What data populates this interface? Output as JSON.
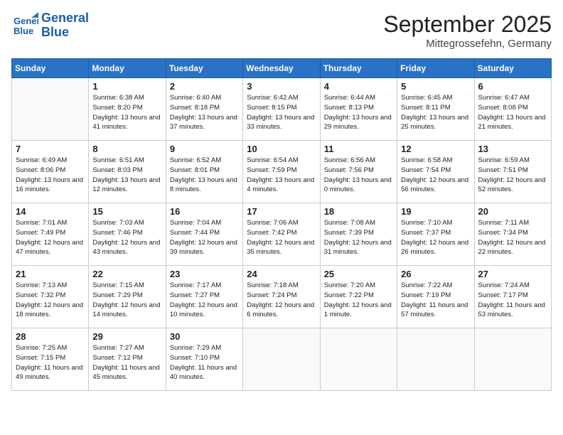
{
  "header": {
    "logo_line1": "General",
    "logo_line2": "Blue",
    "month": "September 2025",
    "location": "Mittegrossefehn, Germany"
  },
  "weekdays": [
    "Sunday",
    "Monday",
    "Tuesday",
    "Wednesday",
    "Thursday",
    "Friday",
    "Saturday"
  ],
  "weeks": [
    [
      {
        "day": "",
        "info": ""
      },
      {
        "day": "1",
        "info": "Sunrise: 6:38 AM\nSunset: 8:20 PM\nDaylight: 13 hours\nand 41 minutes."
      },
      {
        "day": "2",
        "info": "Sunrise: 6:40 AM\nSunset: 8:18 PM\nDaylight: 13 hours\nand 37 minutes."
      },
      {
        "day": "3",
        "info": "Sunrise: 6:42 AM\nSunset: 8:15 PM\nDaylight: 13 hours\nand 33 minutes."
      },
      {
        "day": "4",
        "info": "Sunrise: 6:44 AM\nSunset: 8:13 PM\nDaylight: 13 hours\nand 29 minutes."
      },
      {
        "day": "5",
        "info": "Sunrise: 6:45 AM\nSunset: 8:11 PM\nDaylight: 13 hours\nand 25 minutes."
      },
      {
        "day": "6",
        "info": "Sunrise: 6:47 AM\nSunset: 8:08 PM\nDaylight: 13 hours\nand 21 minutes."
      }
    ],
    [
      {
        "day": "7",
        "info": "Sunrise: 6:49 AM\nSunset: 8:06 PM\nDaylight: 13 hours\nand 16 minutes."
      },
      {
        "day": "8",
        "info": "Sunrise: 6:51 AM\nSunset: 8:03 PM\nDaylight: 13 hours\nand 12 minutes."
      },
      {
        "day": "9",
        "info": "Sunrise: 6:52 AM\nSunset: 8:01 PM\nDaylight: 13 hours\nand 8 minutes."
      },
      {
        "day": "10",
        "info": "Sunrise: 6:54 AM\nSunset: 7:59 PM\nDaylight: 13 hours\nand 4 minutes."
      },
      {
        "day": "11",
        "info": "Sunrise: 6:56 AM\nSunset: 7:56 PM\nDaylight: 13 hours\nand 0 minutes."
      },
      {
        "day": "12",
        "info": "Sunrise: 6:58 AM\nSunset: 7:54 PM\nDaylight: 12 hours\nand 56 minutes."
      },
      {
        "day": "13",
        "info": "Sunrise: 6:59 AM\nSunset: 7:51 PM\nDaylight: 12 hours\nand 52 minutes."
      }
    ],
    [
      {
        "day": "14",
        "info": "Sunrise: 7:01 AM\nSunset: 7:49 PM\nDaylight: 12 hours\nand 47 minutes."
      },
      {
        "day": "15",
        "info": "Sunrise: 7:03 AM\nSunset: 7:46 PM\nDaylight: 12 hours\nand 43 minutes."
      },
      {
        "day": "16",
        "info": "Sunrise: 7:04 AM\nSunset: 7:44 PM\nDaylight: 12 hours\nand 39 minutes."
      },
      {
        "day": "17",
        "info": "Sunrise: 7:06 AM\nSunset: 7:42 PM\nDaylight: 12 hours\nand 35 minutes."
      },
      {
        "day": "18",
        "info": "Sunrise: 7:08 AM\nSunset: 7:39 PM\nDaylight: 12 hours\nand 31 minutes."
      },
      {
        "day": "19",
        "info": "Sunrise: 7:10 AM\nSunset: 7:37 PM\nDaylight: 12 hours\nand 26 minutes."
      },
      {
        "day": "20",
        "info": "Sunrise: 7:11 AM\nSunset: 7:34 PM\nDaylight: 12 hours\nand 22 minutes."
      }
    ],
    [
      {
        "day": "21",
        "info": "Sunrise: 7:13 AM\nSunset: 7:32 PM\nDaylight: 12 hours\nand 18 minutes."
      },
      {
        "day": "22",
        "info": "Sunrise: 7:15 AM\nSunset: 7:29 PM\nDaylight: 12 hours\nand 14 minutes."
      },
      {
        "day": "23",
        "info": "Sunrise: 7:17 AM\nSunset: 7:27 PM\nDaylight: 12 hours\nand 10 minutes."
      },
      {
        "day": "24",
        "info": "Sunrise: 7:18 AM\nSunset: 7:24 PM\nDaylight: 12 hours\nand 6 minutes."
      },
      {
        "day": "25",
        "info": "Sunrise: 7:20 AM\nSunset: 7:22 PM\nDaylight: 12 hours\nand 1 minute."
      },
      {
        "day": "26",
        "info": "Sunrise: 7:22 AM\nSunset: 7:19 PM\nDaylight: 11 hours\nand 57 minutes."
      },
      {
        "day": "27",
        "info": "Sunrise: 7:24 AM\nSunset: 7:17 PM\nDaylight: 11 hours\nand 53 minutes."
      }
    ],
    [
      {
        "day": "28",
        "info": "Sunrise: 7:25 AM\nSunset: 7:15 PM\nDaylight: 11 hours\nand 49 minutes."
      },
      {
        "day": "29",
        "info": "Sunrise: 7:27 AM\nSunset: 7:12 PM\nDaylight: 11 hours\nand 45 minutes."
      },
      {
        "day": "30",
        "info": "Sunrise: 7:29 AM\nSunset: 7:10 PM\nDaylight: 11 hours\nand 40 minutes."
      },
      {
        "day": "",
        "info": ""
      },
      {
        "day": "",
        "info": ""
      },
      {
        "day": "",
        "info": ""
      },
      {
        "day": "",
        "info": ""
      }
    ]
  ]
}
